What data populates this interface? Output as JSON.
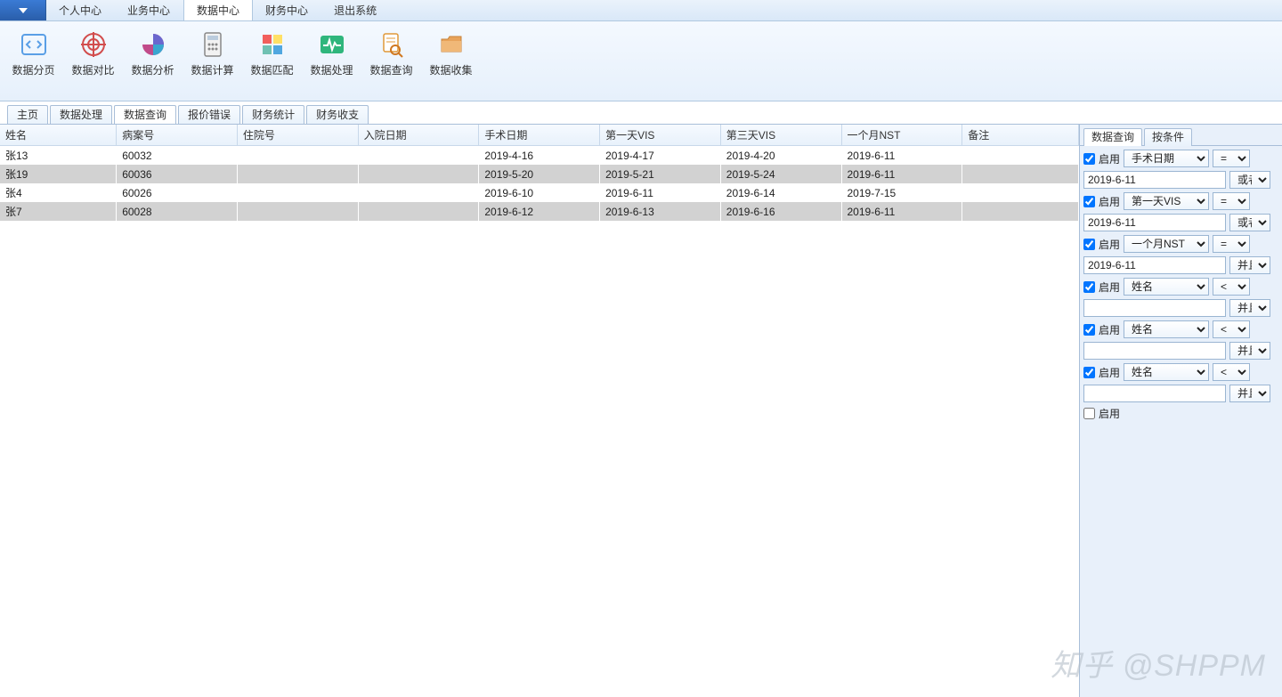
{
  "menubar": {
    "items": [
      {
        "label": "个人中心",
        "active": false
      },
      {
        "label": "业务中心",
        "active": false
      },
      {
        "label": "数据中心",
        "active": true
      },
      {
        "label": "财务中心",
        "active": false
      },
      {
        "label": "退出系统",
        "active": false
      }
    ]
  },
  "ribbon": {
    "buttons": [
      {
        "label": "数据分页",
        "icon": "code-icon",
        "color": "#5a9fe6"
      },
      {
        "label": "数据对比",
        "icon": "target-icon",
        "color": "#d24d4d"
      },
      {
        "label": "数据分析",
        "icon": "piechart-icon",
        "color": "#6a67ce"
      },
      {
        "label": "数据计算",
        "icon": "calculator-icon",
        "color": "#888"
      },
      {
        "label": "数据匹配",
        "icon": "tiles-icon",
        "color": "#f2a13c"
      },
      {
        "label": "数据处理",
        "icon": "pulse-icon",
        "color": "#2fb67c"
      },
      {
        "label": "数据查询",
        "icon": "search-doc-icon",
        "color": "#e09838"
      },
      {
        "label": "数据收集",
        "icon": "folder-icon",
        "color": "#e8a35a"
      }
    ]
  },
  "tabs": {
    "items": [
      {
        "label": "主页",
        "active": false
      },
      {
        "label": "数据处理",
        "active": false
      },
      {
        "label": "数据查询",
        "active": true
      },
      {
        "label": "报价错误",
        "active": false
      },
      {
        "label": "财务统计",
        "active": false
      },
      {
        "label": "财务收支",
        "active": false
      }
    ]
  },
  "table": {
    "columns": [
      "姓名",
      "病案号",
      "住院号",
      "入院日期",
      "手术日期",
      "第一天VIS",
      "第三天VIS",
      "一个月NST",
      "备注"
    ],
    "widths": [
      130,
      135,
      135,
      135,
      135,
      135,
      135,
      135,
      130
    ],
    "rows": [
      [
        "张13",
        "60032",
        "",
        "",
        "2019-4-16",
        "2019-4-17",
        "2019-4-20",
        "2019-6-11",
        ""
      ],
      [
        "张19",
        "60036",
        "",
        "",
        "2019-5-20",
        "2019-5-21",
        "2019-5-24",
        "2019-6-11",
        ""
      ],
      [
        "张4",
        "60026",
        "",
        "",
        "2019-6-10",
        "2019-6-11",
        "2019-6-14",
        "2019-7-15",
        ""
      ],
      [
        "张7",
        "60028",
        "",
        "",
        "2019-6-12",
        "2019-6-13",
        "2019-6-16",
        "2019-6-11",
        ""
      ]
    ]
  },
  "rightPanel": {
    "tabs": [
      {
        "label": "数据查询",
        "active": true
      },
      {
        "label": "按条件",
        "active": false
      }
    ],
    "enable_label": "启用",
    "filters": [
      {
        "enabled": true,
        "field": "手术日期",
        "op": "=",
        "value": "2019-6-11",
        "logic": "或者"
      },
      {
        "enabled": true,
        "field": "第一天VIS",
        "op": "=",
        "value": "2019-6-11",
        "logic": "或者"
      },
      {
        "enabled": true,
        "field": "一个月NST",
        "op": "=",
        "value": "2019-6-11",
        "logic": "并且"
      },
      {
        "enabled": true,
        "field": "姓名",
        "op": "<",
        "value": "",
        "logic": "并且"
      },
      {
        "enabled": true,
        "field": "姓名",
        "op": "<",
        "value": "",
        "logic": "并且"
      },
      {
        "enabled": true,
        "field": "姓名",
        "op": "<",
        "value": "",
        "logic": "并且"
      }
    ],
    "trailing_enable": {
      "enabled": false
    }
  },
  "watermark": "知乎 @SHPPM"
}
